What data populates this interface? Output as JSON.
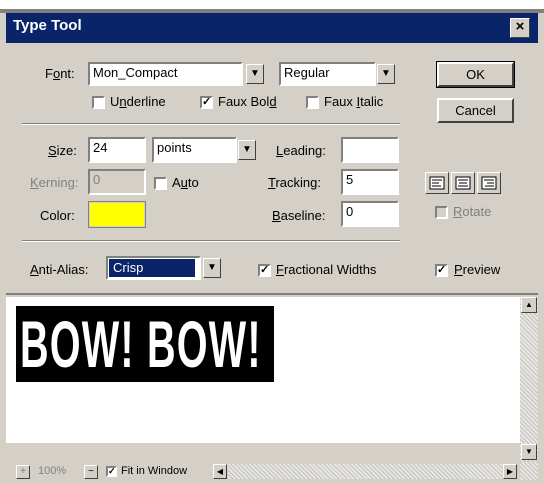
{
  "window": {
    "title": "Type Tool",
    "close_glyph": "×"
  },
  "font": {
    "label_pre": "F",
    "label_ul": "o",
    "label_post": "nt:",
    "family": "Mon_Compact",
    "style": "Regular"
  },
  "checks": {
    "underline": {
      "pre": "U",
      "ul": "n",
      "post": "derline",
      "checked": false
    },
    "faux_bold": {
      "pre": "Faux Bol",
      "ul": "d",
      "post": "",
      "checked": true
    },
    "faux_italic": {
      "pre": "Faux ",
      "ul": "I",
      "post": "talic",
      "checked": false
    }
  },
  "buttons": {
    "ok": "OK",
    "cancel": "Cancel"
  },
  "size": {
    "pre": "",
    "ul": "S",
    "post": "ize:",
    "value": "24",
    "unit": "points"
  },
  "leading": {
    "pre": "",
    "ul": "L",
    "post": "eading:",
    "value": ""
  },
  "kerning": {
    "pre": "",
    "ul": "K",
    "post": "erning:",
    "value": "0"
  },
  "auto": {
    "pre": "A",
    "ul": "u",
    "post": "to",
    "checked": false
  },
  "tracking": {
    "pre": "",
    "ul": "T",
    "post": "racking:",
    "value": "5"
  },
  "color": {
    "label": "Color:",
    "swatch": "#ffff00"
  },
  "baseline": {
    "pre": "",
    "ul": "B",
    "post": "aseline:",
    "value": "0"
  },
  "rotate": {
    "pre": "",
    "ul": "R",
    "post": "otate",
    "checked": false
  },
  "anti_alias": {
    "pre": "",
    "ul": "A",
    "post": "nti-Alias:",
    "value": "Crisp"
  },
  "fractional": {
    "pre": "",
    "ul": "F",
    "post": "ractional Widths",
    "checked": true
  },
  "preview": {
    "pre": "",
    "ul": "P",
    "post": "review",
    "checked": true,
    "text": "BOW!  BOW!"
  },
  "status": {
    "zoom": "100%",
    "fit_label": "Fit in Window",
    "fit_checked": true
  },
  "check_glyph": "✓"
}
